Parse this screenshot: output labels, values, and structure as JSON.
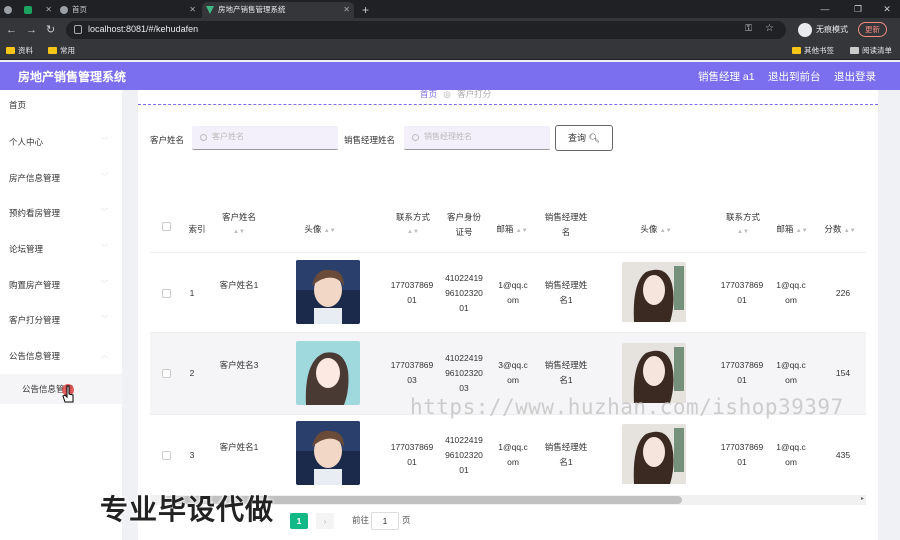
{
  "browser": {
    "tabs": [
      {
        "label": ""
      },
      {
        "label": ""
      },
      {
        "label": "首页"
      },
      {
        "label": "房地产销售管理系统"
      }
    ],
    "url": "localhost:8081/#/kehudafen",
    "incognito_label": "无痕模式",
    "update_label": "更新",
    "bookmarks": [
      "资料",
      "常用"
    ],
    "bookmarks_right": [
      "其他书签",
      "阅读清单"
    ]
  },
  "app": {
    "title": "房地产销售管理系统",
    "header_links": [
      "销售经理 a1",
      "退出到前台",
      "退出登录"
    ]
  },
  "sidebar": {
    "items": [
      {
        "label": "首页"
      },
      {
        "label": "个人中心"
      },
      {
        "label": "房产信息管理"
      },
      {
        "label": "预约看房管理"
      },
      {
        "label": "论坛管理"
      },
      {
        "label": "购置房产管理"
      },
      {
        "label": "客户打分管理"
      },
      {
        "label": "公告信息管理"
      },
      {
        "label": "公告信息管理"
      }
    ]
  },
  "breadcrumb": {
    "home": "首页",
    "current": "客户打分"
  },
  "search": {
    "customer_label": "客户姓名",
    "customer_placeholder": "客户姓名",
    "manager_label": "销售经理姓名",
    "manager_placeholder": "销售经理姓名",
    "button": "查询"
  },
  "table": {
    "headers": [
      "索引",
      "客户姓名",
      "头像",
      "联系方式",
      "客户身份证号",
      "邮箱",
      "销售经理姓名",
      "头像",
      "联系方式",
      "邮箱",
      "分数"
    ],
    "rows": [
      {
        "index": "1",
        "name": "客户姓名1",
        "phone": "17703786901",
        "idcard": "410224199610232001",
        "email": "1@qq.com",
        "manager": "销售经理姓名1",
        "mphone": "17703786901",
        "memail": "1@qq.com",
        "score": "226"
      },
      {
        "index": "2",
        "name": "客户姓名3",
        "phone": "17703786903",
        "idcard": "410224199610232003",
        "email": "3@qq.com",
        "manager": "销售经理姓名1",
        "mphone": "17703786901",
        "memail": "1@qq.com",
        "score": "154"
      },
      {
        "index": "3",
        "name": "客户姓名1",
        "phone": "17703786901",
        "idcard": "410224199610232001",
        "email": "1@qq.com",
        "manager": "销售经理姓名1",
        "mphone": "17703786901",
        "memail": "1@qq.com",
        "score": "435"
      }
    ]
  },
  "pagination": {
    "current": "1",
    "goto_label": "前往",
    "goto_value": "1",
    "page_suffix": "页"
  },
  "overlay_text": "专业毕设代做",
  "watermark": "https://www.huzhan.com/ishop39397",
  "colors": {
    "accent": "#7b6ff0",
    "page_active": "#12b886"
  }
}
